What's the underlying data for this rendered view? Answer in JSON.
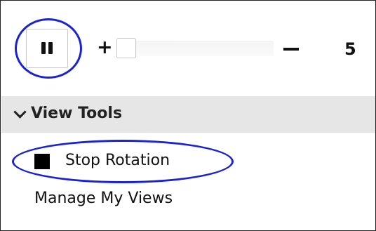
{
  "controls": {
    "pause_icon": "pause-icon",
    "plus_label": "+",
    "minus_label": "−",
    "count": "5",
    "slider_level": 0
  },
  "view_tools": {
    "title": "View Tools",
    "expanded": true,
    "items": [
      {
        "label": "Stop Rotation",
        "icon": "stop-icon"
      },
      {
        "label": "Manage My Views"
      }
    ]
  },
  "colors": {
    "annotation": "#1a22d8",
    "header_bg": "#e6e6e6"
  }
}
